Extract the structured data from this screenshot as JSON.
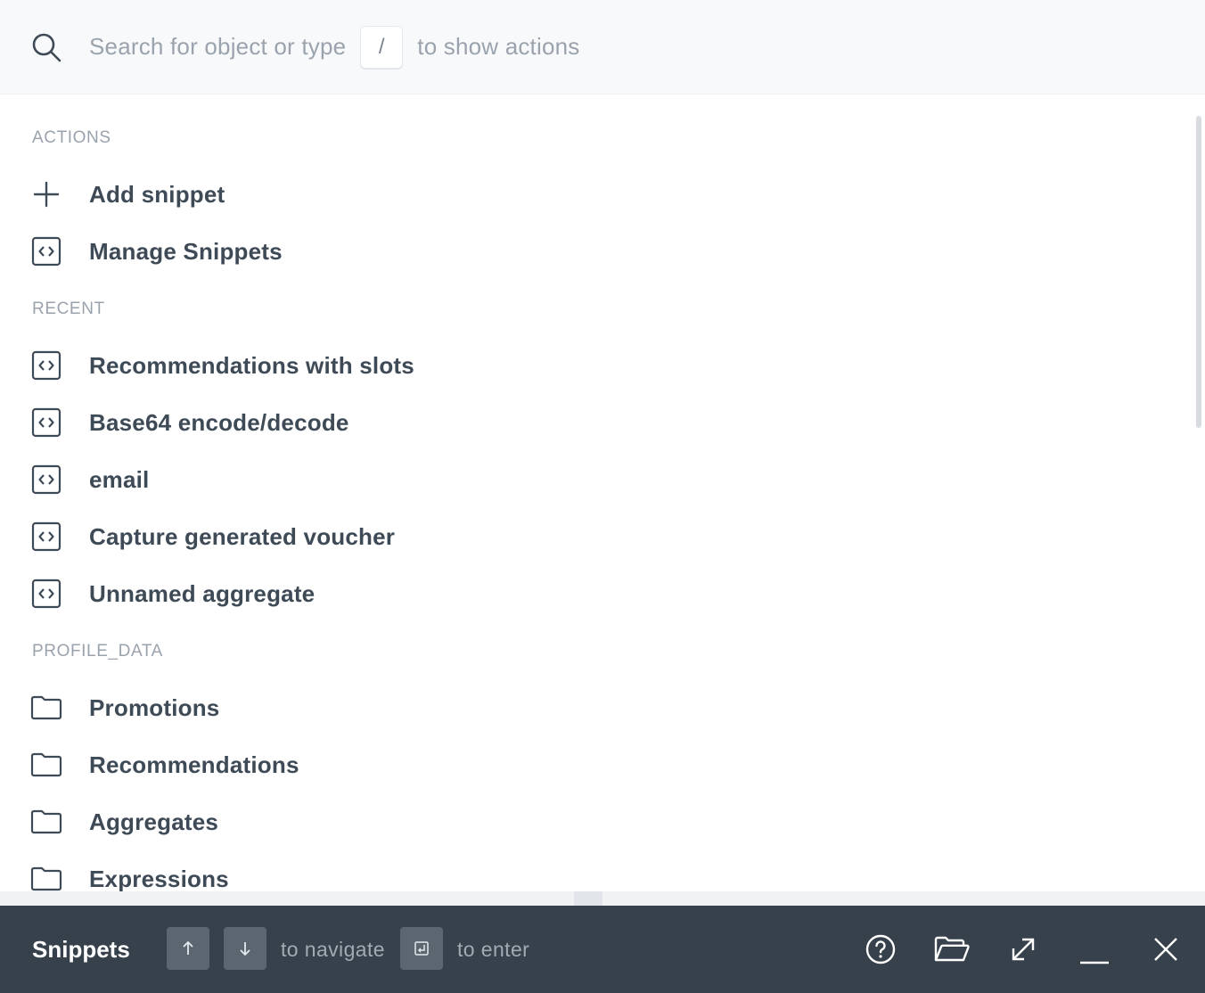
{
  "search": {
    "hint_before": "Search for object or type",
    "key": "/",
    "hint_after": "to show actions"
  },
  "sections": {
    "actions": "ACTIONS",
    "recent": "RECENT",
    "profile_data": "PROFILE_DATA"
  },
  "actions": [
    {
      "label": "Add snippet",
      "icon": "plus-icon"
    },
    {
      "label": "Manage Snippets",
      "icon": "code-snippet-icon"
    }
  ],
  "recent": [
    {
      "label": "Recommendations with slots",
      "icon": "code-snippet-icon"
    },
    {
      "label": "Base64 encode/decode",
      "icon": "code-snippet-icon"
    },
    {
      "label": "email",
      "icon": "code-snippet-icon"
    },
    {
      "label": "Capture generated voucher",
      "icon": "code-snippet-icon"
    },
    {
      "label": "Unnamed aggregate",
      "icon": "code-snippet-icon"
    }
  ],
  "profile_data": [
    {
      "label": "Promotions",
      "icon": "folder-icon"
    },
    {
      "label": "Recommendations",
      "icon": "folder-icon"
    },
    {
      "label": "Aggregates",
      "icon": "folder-icon"
    },
    {
      "label": "Expressions",
      "icon": "folder-icon"
    }
  ],
  "footer": {
    "title": "Snippets",
    "navigate_hint": "to navigate",
    "enter_hint": "to enter",
    "icons": [
      "help-circle-icon",
      "folder-open-icon",
      "expand-icon",
      "minimize-icon",
      "close-icon"
    ]
  },
  "colors": {
    "footer_bg": "#36414c",
    "text": "#3e4a56",
    "muted": "#9aa3ad"
  }
}
